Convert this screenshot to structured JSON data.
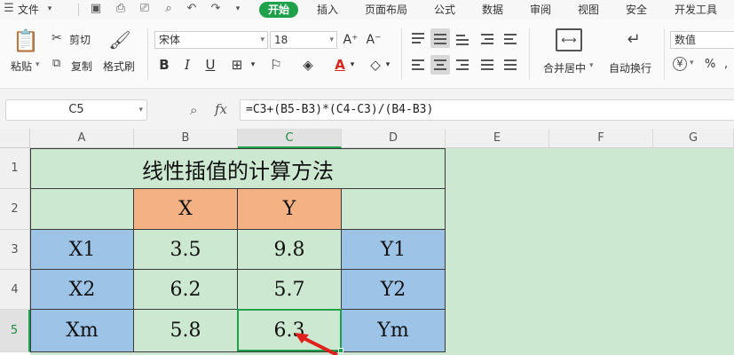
{
  "menu": {
    "file": "文件",
    "tabs": [
      "开始",
      "插入",
      "页面布局",
      "公式",
      "数据",
      "审阅",
      "视图",
      "安全",
      "开发工具"
    ],
    "active_tab": "开始"
  },
  "ribbon": {
    "paste": "粘贴",
    "cut": "剪切",
    "copy": "复制",
    "format_painter": "格式刷",
    "font_name": "宋体",
    "font_size": "18",
    "bold": "B",
    "italic": "I",
    "underline": "U",
    "font_color_glyph": "A",
    "merge_center": "合并居中",
    "wrap_text": "自动换行",
    "number_format": "数值",
    "currency_glyph": "¥",
    "percent_glyph": "%"
  },
  "formula_bar": {
    "cell_ref": "C5",
    "fx": "fx",
    "formula": "=C3+(B5-B3)*(C4-C3)/(B4-B3)"
  },
  "grid": {
    "columns": [
      "A",
      "B",
      "C",
      "D",
      "E",
      "F",
      "G"
    ],
    "rows": [
      "1",
      "2",
      "3",
      "4",
      "5"
    ],
    "selected_column": "C",
    "selected_row": "5"
  },
  "table": {
    "title": "线性插值的计算方法",
    "header_x": "X",
    "header_y": "Y",
    "r3": [
      "X1",
      "3.5",
      "9.8",
      "Y1"
    ],
    "r4": [
      "X2",
      "6.2",
      "5.7",
      "Y2"
    ],
    "r5": [
      "Xm",
      "5.8",
      "6.3",
      "Ym"
    ]
  },
  "colors": {
    "accent": "#1fa04a",
    "header_orange": "#f4b183",
    "label_blue": "#9dc3e6",
    "cell_green": "#cde8d1"
  }
}
